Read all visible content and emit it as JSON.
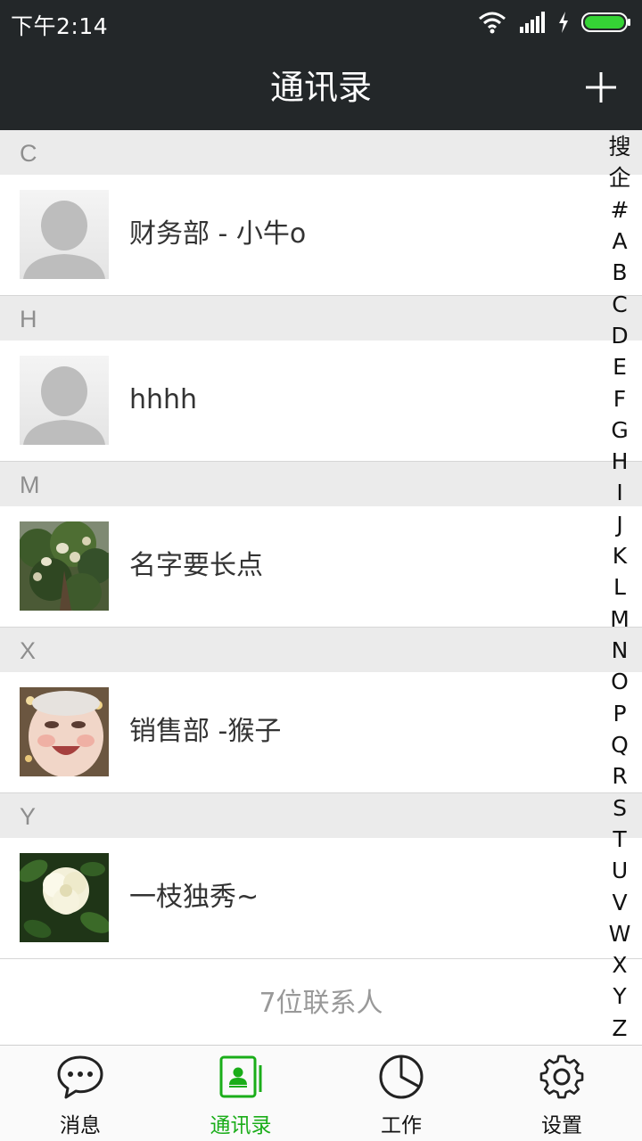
{
  "status_bar": {
    "time": "下午2:14",
    "icons": [
      "wifi-icon",
      "signal-icon",
      "charging-icon",
      "battery-icon"
    ]
  },
  "header": {
    "title": "通讯录",
    "add_icon": "plus-icon"
  },
  "sections": [
    {
      "letter": "C",
      "contacts": [
        {
          "name": "财务部 - 小牛o",
          "avatar": "default-avatar"
        }
      ]
    },
    {
      "letter": "H",
      "contacts": [
        {
          "name": "hhhh",
          "avatar": "default-avatar"
        }
      ]
    },
    {
      "letter": "M",
      "contacts": [
        {
          "name": "名字要长点",
          "avatar": "tree-photo"
        }
      ]
    },
    {
      "letter": "X",
      "contacts": [
        {
          "name": "销售部 -猴子",
          "avatar": "baby-photo"
        }
      ]
    },
    {
      "letter": "Y",
      "contacts": [
        {
          "name": "一枝独秀~",
          "avatar": "flower-photo"
        }
      ]
    }
  ],
  "contact_count": "7位联系人",
  "index_bar": [
    "搜",
    "企",
    "#",
    "A",
    "B",
    "C",
    "D",
    "E",
    "F",
    "G",
    "H",
    "I",
    "J",
    "K",
    "L",
    "M",
    "N",
    "O",
    "P",
    "Q",
    "R",
    "S",
    "T",
    "U",
    "V",
    "W",
    "X",
    "Y",
    "Z"
  ],
  "tabs": [
    {
      "label": "消息",
      "icon": "chat-bubble-icon",
      "active": false
    },
    {
      "label": "通讯录",
      "icon": "contacts-icon",
      "active": true
    },
    {
      "label": "工作",
      "icon": "pie-chart-icon",
      "active": false
    },
    {
      "label": "设置",
      "icon": "gear-icon",
      "active": false
    }
  ],
  "colors": {
    "bar_bg": "#232729",
    "accent": "#1aad19",
    "section_bg": "#ebebeb",
    "battery": "#35d335"
  }
}
